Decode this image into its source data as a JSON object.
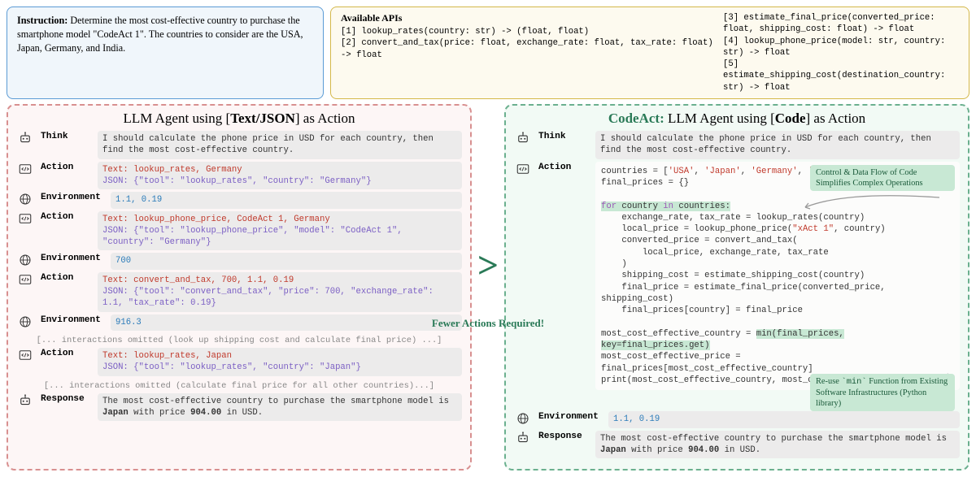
{
  "instruction": {
    "label": "Instruction:",
    "text": "Determine the most cost-effective country to purchase the smartphone model \"CodeAct 1\". The countries to consider are the USA, Japan, Germany, and India."
  },
  "apis": {
    "title": "Available APIs",
    "left": [
      "[1] lookup_rates(country: str) -> (float, float)",
      "[2] convert_and_tax(price: float, exchange_rate: float, tax_rate: float) -> float"
    ],
    "right": [
      "[3] estimate_final_price(converted_price: float, shipping_cost: float) -> float",
      "[4] lookup_phone_price(model: str, country: str) -> float",
      "[5] estimate_shipping_cost(destination_country: str) -> float"
    ]
  },
  "left_panel": {
    "title_pre": "LLM Agent using [",
    "title_bold": "Text/JSON",
    "title_post": "] as Action",
    "think": "I should calculate the phone price in USD for each country, then find the most cost-effective country.",
    "act1_text": "Text: lookup_rates, Germany",
    "act1_json": "JSON: {\"tool\": \"lookup_rates\", \"country\": \"Germany\"}",
    "env1": "1.1, 0.19",
    "act2_text": "Text: lookup_phone_price, CodeAct 1, Germany",
    "act2_json": "JSON: {\"tool\": \"lookup_phone_price\", \"model\": \"CodeAct 1\", \"country\": \"Germany\"}",
    "env2": "700",
    "act3_text": "Text: convert_and_tax, 700, 1.1, 0.19",
    "act3_json": "JSON: {\"tool\": \"convert_and_tax\", \"price\": 700, \"exchange_rate\": 1.1, \"tax_rate\": 0.19}",
    "env3": "916.3",
    "omit1": "[... interactions omitted (look up shipping cost and calculate final price) ...]",
    "act4_text": "Text: lookup_rates, Japan",
    "act4_json": "JSON: {\"tool\": \"lookup_rates\", \"country\": \"Japan\"}",
    "omit2": "[... interactions omitted (calculate final price for all other countries)...]",
    "response_pre": "The most cost-effective country to purchase the smartphone model is ",
    "response_bold1": "Japan",
    "response_mid": " with price ",
    "response_bold2": "904.00",
    "response_post": " in USD."
  },
  "right_panel": {
    "title_pre_bold": "CodeAct:",
    "title_mid": " LLM Agent using [",
    "title_bold": "Code",
    "title_post": "] as Action",
    "think": "I should calculate the phone price in USD for each country, then find the most cost-effective country.",
    "callout1": "Control & Data Flow of Code Simplifies Complex Operations",
    "callout2_pre": "Re-use ",
    "callout2_code": "`min`",
    "callout2_post": " Function from Existing Software Infrastructures (Python library)",
    "env": "1.1, 0.19",
    "response_pre": "The most cost-effective country to purchase the smartphone model is ",
    "response_bold1": "Japan",
    "response_mid": " with price ",
    "response_bold2": "904.00",
    "response_post": " in USD."
  },
  "center": {
    "gt": ">",
    "fewer": "Fewer Actions Required!"
  },
  "labels": {
    "think": "Think",
    "action": "Action",
    "env": "Environment",
    "response": "Response"
  }
}
